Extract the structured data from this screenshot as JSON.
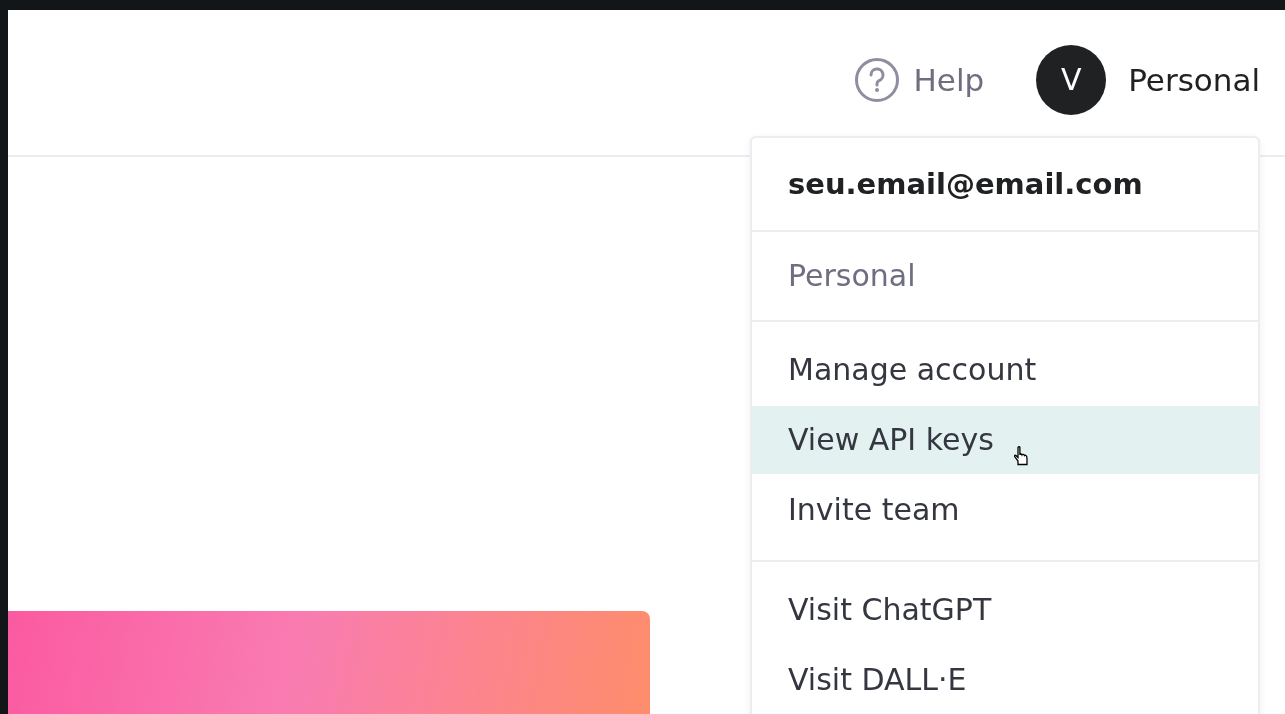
{
  "header": {
    "help": "Help",
    "avatar": "V",
    "account": "Personal"
  },
  "menu": {
    "email": "seu.email@email.com",
    "organization": "Personal",
    "groups": [
      [
        {
          "label": "Manage account",
          "selected": false
        },
        {
          "label": "View API keys",
          "selected": true
        },
        {
          "label": "Invite team",
          "selected": false
        }
      ],
      [
        {
          "label": "Visit ChatGPT",
          "selected": false
        },
        {
          "label": "Visit DALL·E",
          "selected": false
        }
      ]
    ]
  }
}
